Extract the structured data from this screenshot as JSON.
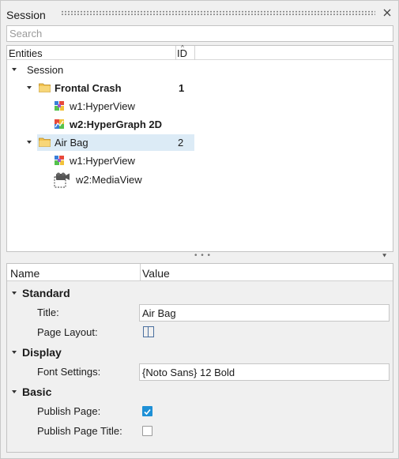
{
  "panel": {
    "title": "Session",
    "search_placeholder": "Search"
  },
  "tree": {
    "columns": {
      "entities": "Entities",
      "id": "ID"
    },
    "root": "Session",
    "items": [
      {
        "label": "Frontal Crash",
        "id": "1",
        "children": [
          {
            "label": "w1:HyperView",
            "icon": "hyperview-icon"
          },
          {
            "label": "w2:HyperGraph 2D",
            "icon": "hypergraph-icon"
          }
        ]
      },
      {
        "label": "Air Bag",
        "id": "2",
        "selected": true,
        "children": [
          {
            "label": "w1:HyperView",
            "icon": "hyperview-icon"
          },
          {
            "label": "w2:MediaView",
            "icon": "mediaview-icon"
          }
        ]
      }
    ]
  },
  "props": {
    "columns": {
      "name": "Name",
      "value": "Value"
    },
    "groups": {
      "standard": "Standard",
      "display": "Display",
      "basic": "Basic"
    },
    "title_label": "Title:",
    "title_value": "Air Bag",
    "page_layout_label": "Page Layout:",
    "font_settings_label": "Font Settings:",
    "font_settings_value": "{Noto Sans} 12 Bold",
    "publish_page_label": "Publish Page:",
    "publish_page_checked": true,
    "publish_page_title_label": "Publish Page Title:",
    "publish_page_title_checked": false
  },
  "colors": {
    "selection": "#dcebf6",
    "checkbox_on": "#1e90d6",
    "folder": "#f2c14e"
  }
}
